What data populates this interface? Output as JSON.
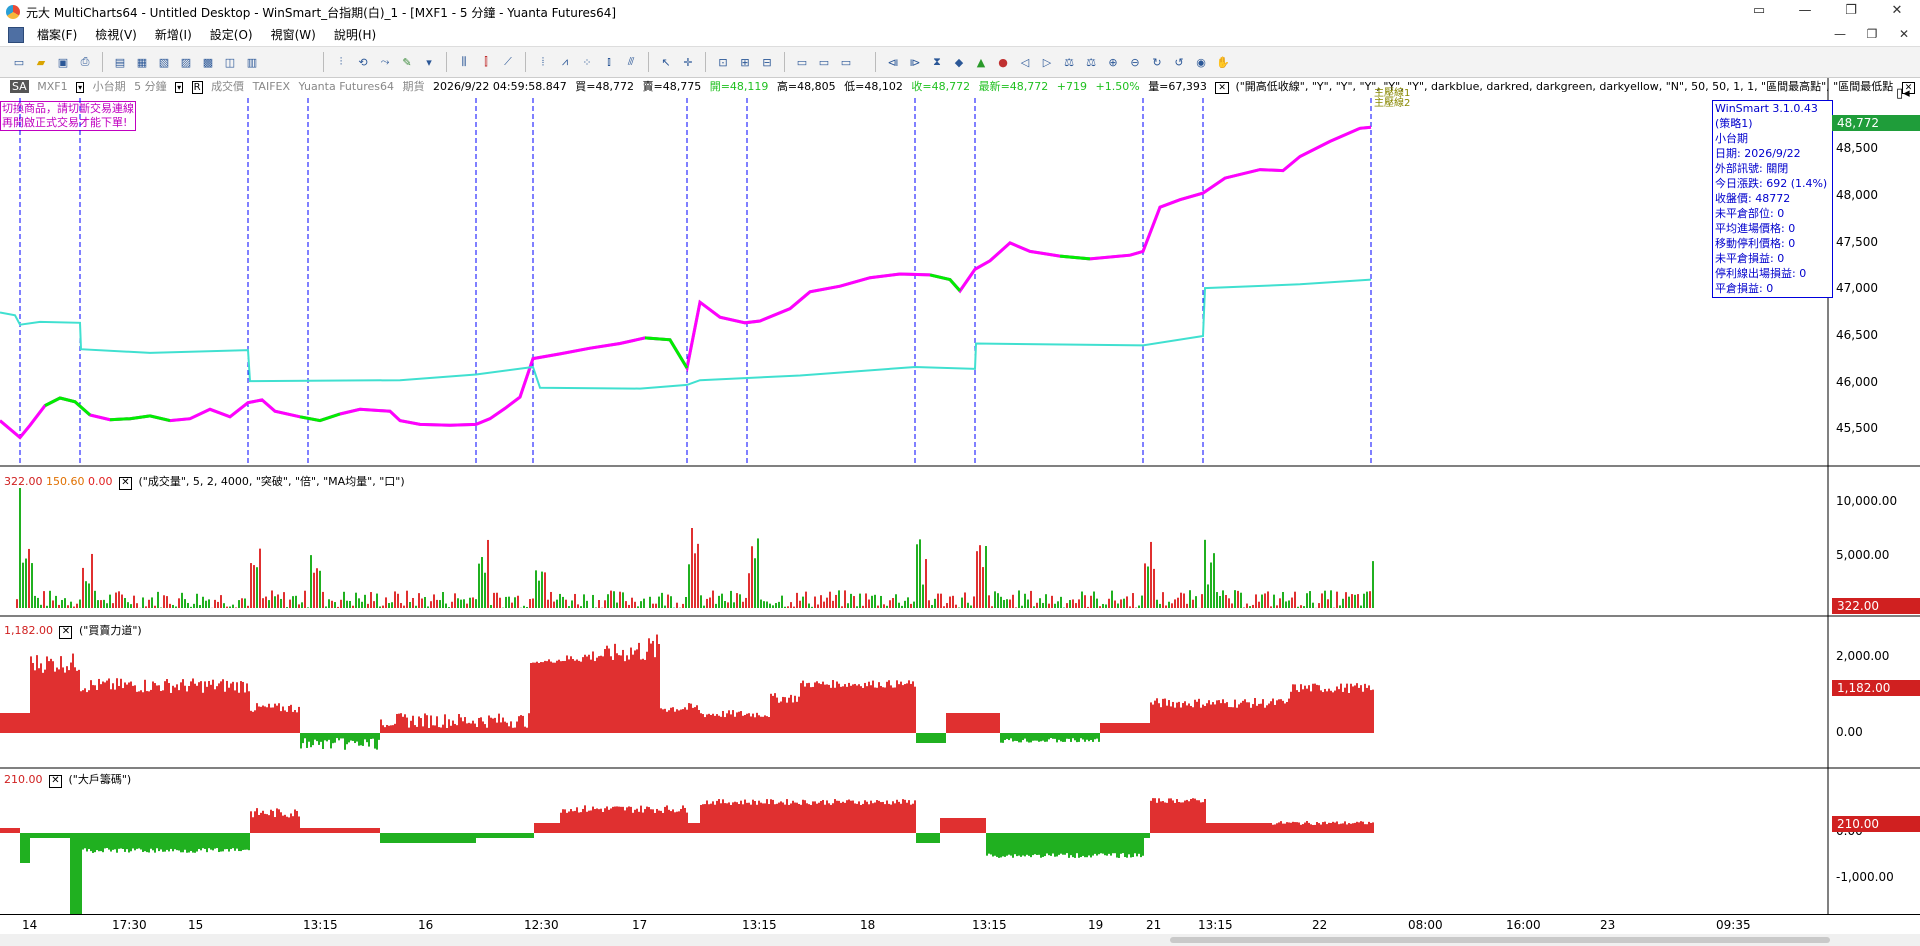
{
  "window": {
    "title": "元大 MultiCharts64 - Untitled Desktop - WinSmart_台指期(白)_1 - [MXF1 - 5 分鐘 - Yuanta Futures64]",
    "buttons": [
      "▭",
      "—",
      "❐",
      "✕"
    ]
  },
  "menu": {
    "items": [
      "檔案(F)",
      "檢視(V)",
      "新增(I)",
      "設定(O)",
      "視窗(W)",
      "說明(H)"
    ],
    "mdi_buttons": [
      "—",
      "❐",
      "✕"
    ]
  },
  "status": {
    "sa": "SA",
    "symbol": "MXF1",
    "product": "小台期",
    "interval": "5 分鐘",
    "r": "R",
    "field": "成交價",
    "exchange": "TAIFEX",
    "feed": "Yuanta Futures64",
    "kind": "期貨",
    "datetime": "2026/9/22   04:59:58.847",
    "buy": "買=48,772",
    "sell": "賣=48,775",
    "open": "開=48,119",
    "high": "高=48,805",
    "low": "低=48,102",
    "close": "收=48,772",
    "last": "最新=48,772",
    "change": "+719",
    "pct": "+1.50%",
    "volume": "量=67,393",
    "study": "(\"開高低收線\", \"Y\", \"Y\", \"Y\", \"Y\", \"Y\", darkblue, darkred, darkgreen, darkyellow, \"N\", 50, 50, 1, 1, \"區間最高點\", \"區間最低點",
    "study2": "(\""
  },
  "warning": {
    "line1": "切換商品，請切斷交易連線",
    "line2": "再開啟正式交易才能下單!"
  },
  "info": {
    "lines": [
      "WinSmart 3.1.0.43",
      "(策略1)",
      "小台期",
      "日期: 2026/9/22",
      "外部訊號: 關閉",
      "今日漲跌: 692 (1.4%)",
      "收盤價: 48772",
      "未平倉部位: 0",
      "平均進場價格: 0",
      "移動停利價格: 0",
      "未平倉損益: 0",
      "停利線出場損益: 0",
      "平倉損益: 0"
    ]
  },
  "price_panel": {
    "tag": "48,772",
    "axis": [
      "48,500",
      "48,000",
      "47,500",
      "47,000",
      "46,500",
      "46,000",
      "45,500"
    ],
    "pressure_labels": [
      "主壓線1",
      "主壓線2"
    ]
  },
  "volume_panel": {
    "values": [
      "322.00",
      "150.60",
      "0.00"
    ],
    "study": "(\"成交量\", 5, 2, 4000, \"突破\", \"倍\", \"MA均量\", \"口\")",
    "tag": "322.00",
    "axis": [
      "10,000.00",
      "5,000.00"
    ]
  },
  "force_panel": {
    "value": "1,182.00",
    "study": "(\"買賣力道\")",
    "tag": "1,182.00",
    "axis": [
      "2,000.00",
      "0.00"
    ]
  },
  "big_panel": {
    "value": "210.00",
    "study": "(\"大戶籌碼\")",
    "tag": "210.00",
    "axis": [
      "0.00",
      "-1,000.00"
    ]
  },
  "time_axis": [
    "14",
    "17:30",
    "15",
    "13:15",
    "16",
    "12:30",
    "17",
    "13:15",
    "18",
    "13:15",
    "19",
    "21",
    "13:15",
    "22",
    "08:00",
    "16:00",
    "23",
    "09:35"
  ],
  "colors": {
    "up": "#e03030",
    "down": "#20b020",
    "ma": "#40e0d0",
    "trend_up": "#ff00ff",
    "trend_dn": "#00ee00",
    "session": "#0000ff",
    "info": "#0000cc"
  },
  "icons": [
    "desktop-icon",
    "folder-icon",
    "save-icon",
    "print-icon",
    "chart-icon",
    "indicator-icon",
    "strategy-icon",
    "cursor-icon",
    "crosshair-icon",
    "zoom-in-icon",
    "zoom-out-icon",
    "hand-icon"
  ]
}
